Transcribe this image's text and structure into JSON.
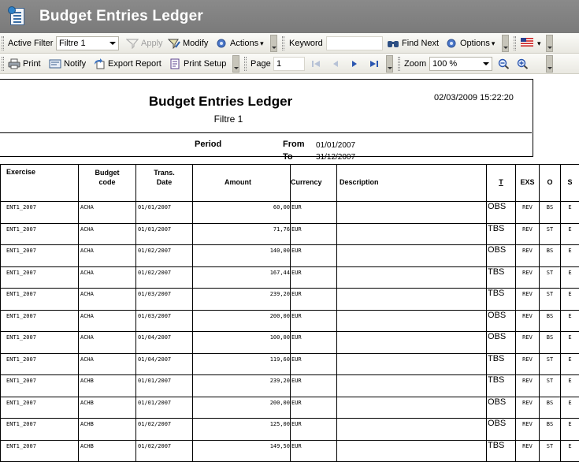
{
  "window": {
    "title": "Budget Entries Ledger"
  },
  "toolbar1": {
    "active_filter_label": "Active Filter",
    "active_filter_value": "Filtre 1",
    "apply_label": "Apply",
    "modify_label": "Modify",
    "actions_label": "Actions",
    "keyword_label": "Keyword",
    "keyword_value": "",
    "find_next_label": "Find Next",
    "options_label": "Options",
    "language_icon": "us-flag-icon"
  },
  "toolbar2": {
    "print_label": "Print",
    "notify_label": "Notify",
    "export_label": "Export Report",
    "print_setup_label": "Print Setup",
    "page_label": "Page",
    "page_value": "1",
    "zoom_label": "Zoom",
    "zoom_value": "100 %"
  },
  "report": {
    "title": "Budget Entries Ledger",
    "filter": "Filtre 1",
    "printed_at": "02/03/2009 15:22:20",
    "period_label": "Period",
    "from_label": "From",
    "from_value": "01/01/2007",
    "to_label": "To",
    "to_value": "31/12/2007",
    "columns": {
      "exercise": "Exercise",
      "budget_code_1": "Budget",
      "budget_code_2": "code",
      "trans_date_1": "Trans.",
      "trans_date_2": "Date",
      "amount": "Amount",
      "currency": "Currency",
      "description": "Description",
      "t": "T",
      "exs": "EXS",
      "o": "O",
      "s": "S"
    },
    "rows": [
      {
        "exercise": "ENT1_2007",
        "budget_code": "ACHA",
        "trans_date": "01/01/2007",
        "amount": "60,00",
        "currency": "EUR",
        "description": "",
        "t": "OBS",
        "exs": "REV",
        "o": "BS",
        "s": "E"
      },
      {
        "exercise": "ENT1_2007",
        "budget_code": "ACHA",
        "trans_date": "01/01/2007",
        "amount": "71,76",
        "currency": "EUR",
        "description": "",
        "t": "TBS",
        "exs": "REV",
        "o": "ST",
        "s": "E"
      },
      {
        "exercise": "ENT1_2007",
        "budget_code": "ACHA",
        "trans_date": "01/02/2007",
        "amount": "140,00",
        "currency": "EUR",
        "description": "",
        "t": "OBS",
        "exs": "REV",
        "o": "BS",
        "s": "E"
      },
      {
        "exercise": "ENT1_2007",
        "budget_code": "ACHA",
        "trans_date": "01/02/2007",
        "amount": "167,44",
        "currency": "EUR",
        "description": "",
        "t": "TBS",
        "exs": "REV",
        "o": "ST",
        "s": "E"
      },
      {
        "exercise": "ENT1_2007",
        "budget_code": "ACHA",
        "trans_date": "01/03/2007",
        "amount": "239,20",
        "currency": "EUR",
        "description": "",
        "t": "TBS",
        "exs": "REV",
        "o": "ST",
        "s": "E"
      },
      {
        "exercise": "ENT1_2007",
        "budget_code": "ACHA",
        "trans_date": "01/03/2007",
        "amount": "200,00",
        "currency": "EUR",
        "description": "",
        "t": "OBS",
        "exs": "REV",
        "o": "BS",
        "s": "E"
      },
      {
        "exercise": "ENT1_2007",
        "budget_code": "ACHA",
        "trans_date": "01/04/2007",
        "amount": "100,00",
        "currency": "EUR",
        "description": "",
        "t": "OBS",
        "exs": "REV",
        "o": "BS",
        "s": "E"
      },
      {
        "exercise": "ENT1_2007",
        "budget_code": "ACHA",
        "trans_date": "01/04/2007",
        "amount": "119,60",
        "currency": "EUR",
        "description": "",
        "t": "TBS",
        "exs": "REV",
        "o": "ST",
        "s": "E"
      },
      {
        "exercise": "ENT1_2007",
        "budget_code": "ACHB",
        "trans_date": "01/01/2007",
        "amount": "239,20",
        "currency": "EUR",
        "description": "",
        "t": "TBS",
        "exs": "REV",
        "o": "ST",
        "s": "E"
      },
      {
        "exercise": "ENT1_2007",
        "budget_code": "ACHB",
        "trans_date": "01/01/2007",
        "amount": "200,00",
        "currency": "EUR",
        "description": "",
        "t": "OBS",
        "exs": "REV",
        "o": "BS",
        "s": "E"
      },
      {
        "exercise": "ENT1_2007",
        "budget_code": "ACHB",
        "trans_date": "01/02/2007",
        "amount": "125,00",
        "currency": "EUR",
        "description": "",
        "t": "OBS",
        "exs": "REV",
        "o": "BS",
        "s": "E"
      },
      {
        "exercise": "ENT1_2007",
        "budget_code": "ACHB",
        "trans_date": "01/02/2007",
        "amount": "149,50",
        "currency": "EUR",
        "description": "",
        "t": "TBS",
        "exs": "REV",
        "o": "ST",
        "s": "E"
      }
    ]
  }
}
